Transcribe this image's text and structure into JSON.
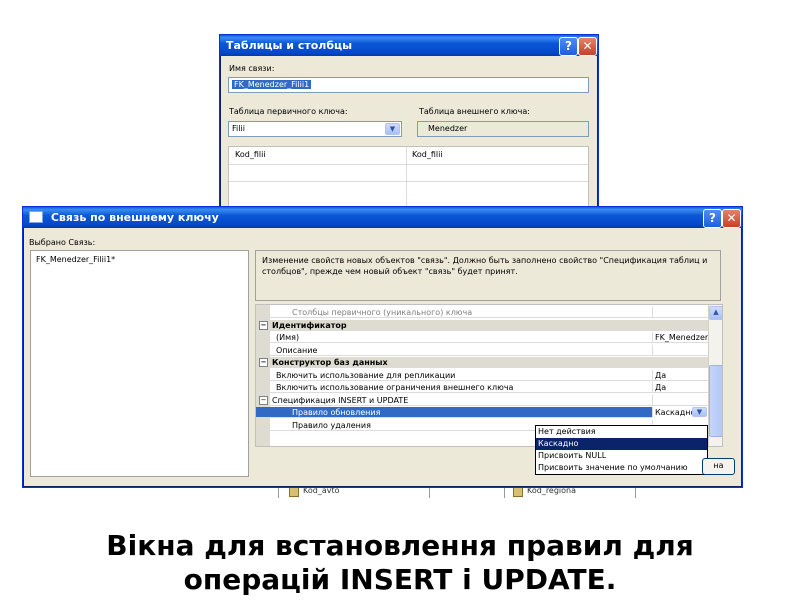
{
  "back_window": {
    "title": "Таблицы и столбцы",
    "relation_name_label": "Имя связи:",
    "relation_name_value": "FK_Menedzer_Filii1",
    "pk_table_label": "Таблица первичного ключа:",
    "pk_table_value": "Filii",
    "fk_table_label": "Таблица внешнего ключа:",
    "fk_table_value": "Menedzer",
    "pk_column": "Kod_filii",
    "fk_column": "Kod_filii"
  },
  "front_window": {
    "title": "Связь по внешнему ключу",
    "selected_label": "Выбрано Связь:",
    "selected_item": "FK_Menedzer_Filii1*",
    "description": "Изменение свойств новых объектов \"связь\".  Должно быть заполнено свойство \"Спецификация таблиц и столбцов\", прежде чем новый объект \"связь\" будет принят.",
    "properties": [
      {
        "kind": "sub",
        "name": "Столбцы первичного (уникального) ключа",
        "value": ""
      },
      {
        "kind": "category",
        "name": "Идентификатор",
        "value": ""
      },
      {
        "kind": "prop",
        "name": "(Имя)",
        "value": "FK_Menedzer_F"
      },
      {
        "kind": "prop",
        "name": "Описание",
        "value": ""
      },
      {
        "kind": "category",
        "name": "Конструктор баз данных",
        "value": ""
      },
      {
        "kind": "prop",
        "name": "Включить использование для репликации",
        "value": "Да"
      },
      {
        "kind": "prop",
        "name": "Включить использование ограничения внешнего ключа",
        "value": "Да"
      },
      {
        "kind": "group",
        "name": "Спецификация INSERT и UPDATE",
        "value": ""
      },
      {
        "kind": "selected",
        "name": "Правило обновления",
        "value": "Каскадно"
      },
      {
        "kind": "sub2",
        "name": "Правило удаления",
        "value": ""
      }
    ],
    "dropdown_options": [
      "Нет действия",
      "Каскадно",
      "Присвоить NULL",
      "Присвоить значение по умолчанию"
    ],
    "dropdown_selected": "Каскадно",
    "close_button_partial": "на"
  },
  "background_items": {
    "left_table_field": "Kod_avto",
    "right_table_field": "Kod_regiona"
  },
  "caption": {
    "line1": "Вікна для встановлення правил для",
    "line2": "операцій INSERT  і  UPDATE."
  },
  "colors": {
    "title_bar": "#0a58d6",
    "window_bg": "#ece9d8",
    "selection": "#0a246a"
  }
}
